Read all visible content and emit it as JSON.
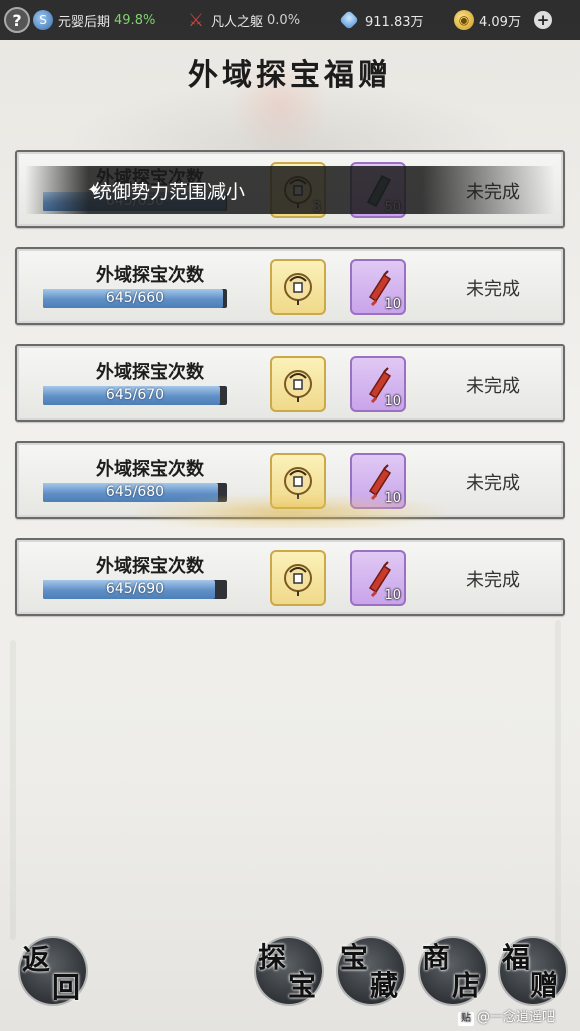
{
  "status_bar": {
    "help_label": "?",
    "realm": {
      "icon": "yin-yang-icon",
      "label": "元婴后期",
      "percent": "49.8%"
    },
    "body": {
      "icon": "sword-body-icon",
      "label": "凡人之躯",
      "percent": "0.0%"
    },
    "spirit_stones": {
      "icon": "spirit-stone-icon",
      "value": "911.83万"
    },
    "gold": {
      "icon": "gold-coin-icon",
      "value": "4.09万"
    },
    "plus_label": "+"
  },
  "page_title": "外域探宝福赠",
  "toast": {
    "icon": "sparkle-icon",
    "text": "统御势力范围减小"
  },
  "quests": [
    {
      "label": "外域探宝次数",
      "current": 645,
      "target": 650,
      "progress_text": "645/650",
      "progress": 0.992,
      "rewards": [
        {
          "type": "gold",
          "icon": "lantern-icon",
          "count": "3"
        },
        {
          "type": "purple",
          "icon": "banner-icon",
          "count": "50"
        }
      ],
      "status": "未完成"
    },
    {
      "label": "外域探宝次数",
      "current": 645,
      "target": 660,
      "progress_text": "645/660",
      "progress": 0.977,
      "rewards": [
        {
          "type": "gold",
          "icon": "lantern-icon",
          "count": ""
        },
        {
          "type": "purple",
          "icon": "scroll-icon",
          "count": "10"
        }
      ],
      "status": "未完成"
    },
    {
      "label": "外域探宝次数",
      "current": 645,
      "target": 670,
      "progress_text": "645/670",
      "progress": 0.963,
      "rewards": [
        {
          "type": "gold",
          "icon": "lantern-icon",
          "count": ""
        },
        {
          "type": "purple",
          "icon": "scroll-icon",
          "count": "10"
        }
      ],
      "status": "未完成"
    },
    {
      "label": "外域探宝次数",
      "current": 645,
      "target": 680,
      "progress_text": "645/680",
      "progress": 0.949,
      "rewards": [
        {
          "type": "gold",
          "icon": "lantern-icon",
          "count": ""
        },
        {
          "type": "purple",
          "icon": "scroll-icon",
          "count": "10"
        }
      ],
      "status": "未完成"
    },
    {
      "label": "外域探宝次数",
      "current": 645,
      "target": 690,
      "progress_text": "645/690",
      "progress": 0.935,
      "rewards": [
        {
          "type": "gold",
          "icon": "lantern-icon",
          "count": ""
        },
        {
          "type": "purple",
          "icon": "scroll-icon",
          "count": "10"
        }
      ],
      "status": "未完成"
    }
  ],
  "bottom_nav": {
    "back": [
      "返",
      "回"
    ],
    "explore": [
      "探",
      "宝"
    ],
    "treasury": [
      "宝",
      "藏"
    ],
    "shop": [
      "商",
      "店"
    ],
    "gift": [
      "福",
      "赠"
    ]
  },
  "watermark": {
    "logo": "贴",
    "text": "@一念逍遥吧"
  }
}
